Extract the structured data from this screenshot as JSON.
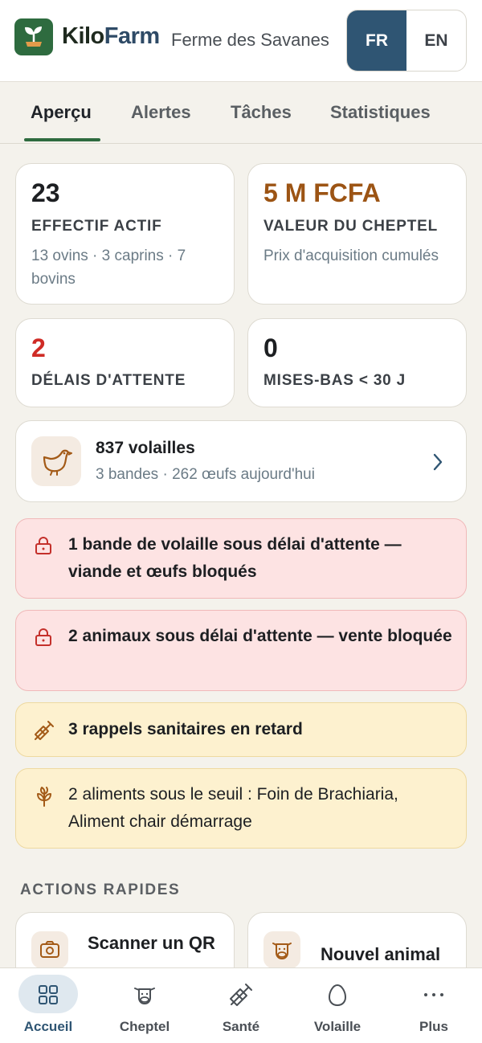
{
  "header": {
    "brand_kilo": "Kilo",
    "brand_farm": "Farm",
    "farm_name": "Ferme des Savanes",
    "lang_fr": "FR",
    "lang_en": "EN",
    "active_lang": "FR"
  },
  "tabs": [
    {
      "label": "Aperçu",
      "active": true
    },
    {
      "label": "Alertes",
      "active": false
    },
    {
      "label": "Tâches",
      "active": false
    },
    {
      "label": "Statistiques",
      "active": false
    }
  ],
  "stats": {
    "herd": {
      "value": "23",
      "label": "EFFECTIF ACTIF",
      "sub": "13 ovins · 3 caprins · 7 bovins"
    },
    "value": {
      "value": "5 M FCFA",
      "label": "VALEUR DU CHEPTEL",
      "sub": "Prix d'acquisition cumulés"
    },
    "withdrawal": {
      "value": "2",
      "label": "DÉLAIS D'ATTENTE"
    },
    "births": {
      "value": "0",
      "label": "MISES-BAS < 30 J"
    }
  },
  "poultry": {
    "title": "837 volailles",
    "sub": "3 bandes · 262 œufs aujourd'hui"
  },
  "alerts": [
    {
      "type": "withdrawal-poultry",
      "level": "red",
      "icon": "lock-icon",
      "text": "1 bande de volaille sous délai d'attente — viande et œufs bloqués"
    },
    {
      "type": "withdrawal-animals",
      "level": "red",
      "icon": "lock-icon",
      "text": "2 animaux sous délai d'attente — vente bloquée"
    },
    {
      "type": "vaccines",
      "level": "yellow",
      "icon": "syringe-icon",
      "text": "3 rappels sanitaires en retard"
    },
    {
      "type": "feed",
      "level": "yellow",
      "icon": "wheat-icon",
      "text": "2 aliments sous le seuil : Foin de Brachiaria, Aliment chair démarrage"
    }
  ],
  "quick_actions": {
    "title": "ACTIONS RAPIDES",
    "items": [
      {
        "label": "Scanner un QR",
        "icon": "camera-icon"
      },
      {
        "label": "Nouvel animal",
        "icon": "cow-icon"
      }
    ]
  },
  "bottom_nav": [
    {
      "label": "Accueil",
      "icon": "grid-icon",
      "active": true
    },
    {
      "label": "Cheptel",
      "icon": "cow-icon",
      "active": false
    },
    {
      "label": "Santé",
      "icon": "syringe-icon",
      "active": false
    },
    {
      "label": "Volaille",
      "icon": "egg-icon",
      "active": false
    },
    {
      "label": "Plus",
      "icon": "more-icon",
      "active": false
    }
  ],
  "colors": {
    "primary_green": "#2e6b3f",
    "primary_blue": "#2f5573",
    "value_brown": "#9c5414",
    "alert_red": "#cf2b25",
    "alert_red_bg": "#fde3e3",
    "alert_yellow_bg": "#fdf1cf"
  }
}
